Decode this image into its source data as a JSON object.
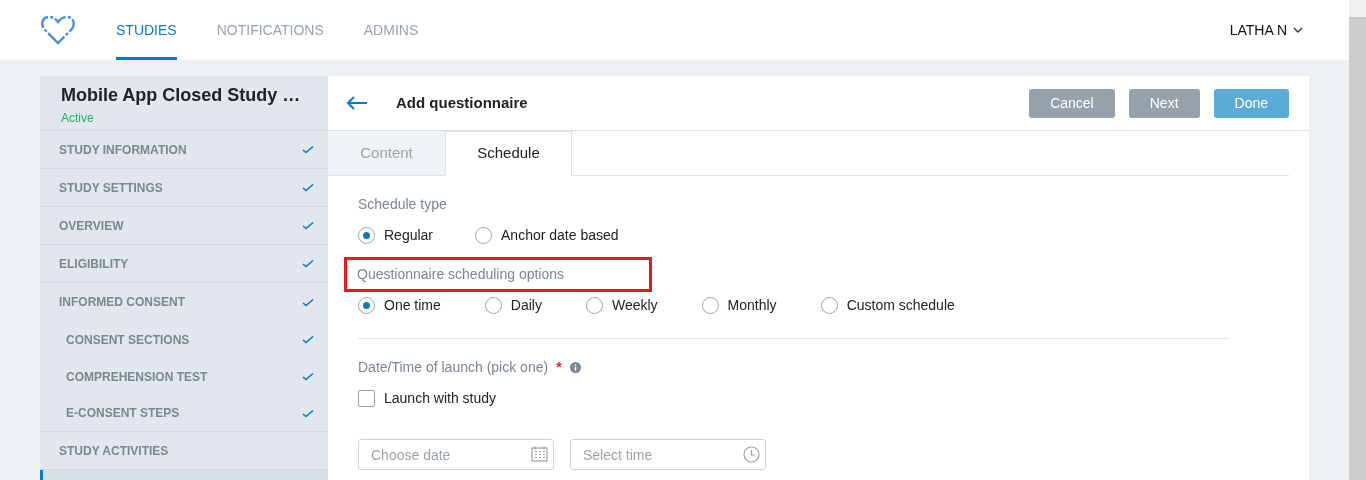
{
  "nav": {
    "tabs": [
      {
        "label": "STUDIES",
        "selected": true
      },
      {
        "label": "NOTIFICATIONS",
        "selected": false
      },
      {
        "label": "ADMINS",
        "selected": false
      }
    ],
    "user": "LATHA N"
  },
  "sidebar": {
    "title": "Mobile App Closed Study …",
    "status": "Active",
    "items": [
      {
        "label": "STUDY INFORMATION",
        "done": true
      },
      {
        "label": "STUDY SETTINGS",
        "done": true
      },
      {
        "label": "OVERVIEW",
        "done": true
      },
      {
        "label": "ELIGIBILITY",
        "done": true
      },
      {
        "label": "INFORMED CONSENT",
        "done": true,
        "children": [
          {
            "label": "CONSENT SECTIONS",
            "done": true
          },
          {
            "label": "COMPREHENSION TEST",
            "done": true
          },
          {
            "label": "E-CONSENT STEPS",
            "done": true
          }
        ]
      },
      {
        "label": "STUDY ACTIVITIES",
        "done": false
      }
    ]
  },
  "panel": {
    "title": "Add questionnaire",
    "buttons": [
      {
        "label": "Cancel",
        "kind": "secondary"
      },
      {
        "label": "Next",
        "kind": "secondary"
      },
      {
        "label": "Done",
        "kind": "primary"
      }
    ],
    "tabs": [
      {
        "label": "Content",
        "selected": false
      },
      {
        "label": "Schedule",
        "selected": true
      }
    ],
    "schedule_type": {
      "label": "Schedule type",
      "options": [
        {
          "label": "Regular",
          "selected": true
        },
        {
          "label": "Anchor date based",
          "selected": false
        }
      ]
    },
    "scheduling_options": {
      "label": "Questionnaire scheduling options",
      "highlighted": true,
      "options": [
        {
          "label": "One time",
          "selected": true
        },
        {
          "label": "Daily",
          "selected": false
        },
        {
          "label": "Weekly",
          "selected": false
        },
        {
          "label": "Monthly",
          "selected": false
        },
        {
          "label": "Custom schedule",
          "selected": false
        }
      ]
    },
    "launch": {
      "label": "Date/Time of launch (pick one)",
      "required": "*",
      "checkbox": {
        "label": "Launch with study",
        "checked": false
      },
      "date": {
        "placeholder": "Choose date"
      },
      "time": {
        "placeholder": "Select time"
      }
    }
  }
}
